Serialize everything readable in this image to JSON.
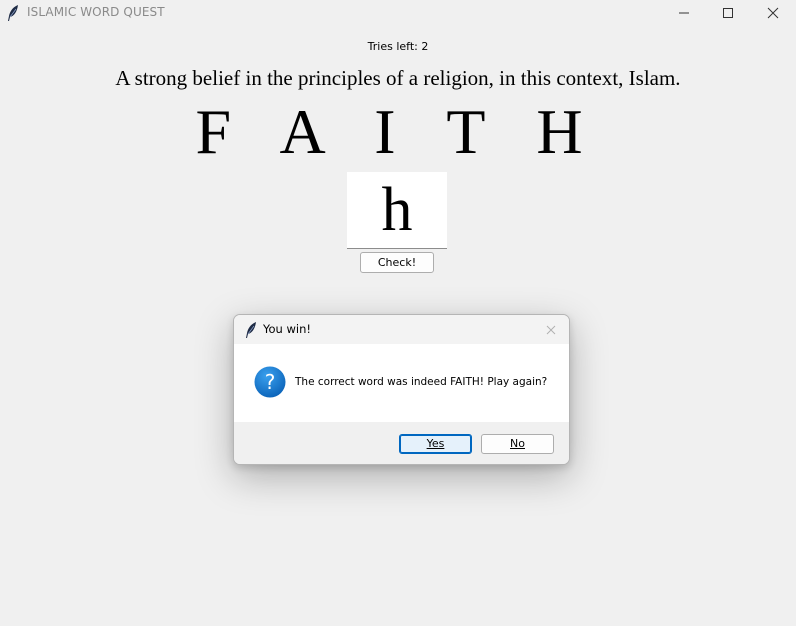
{
  "window": {
    "title": "ISLAMIC WORD QUEST",
    "app_icon": "feather-icon",
    "controls": [
      "minimize-icon",
      "maximize-icon",
      "close-icon"
    ]
  },
  "game": {
    "tries_label": "Tries left: 2",
    "hint": "A strong belief in the principles of a religion, in this context, Islam.",
    "word": "F A I T H",
    "input_value": "h",
    "check_button": "Check!"
  },
  "dialog": {
    "title": "You win!",
    "icon": "question-icon",
    "message": "The correct word was indeed FAITH! Play again?",
    "yes_label": "Yes",
    "no_label": "No",
    "accent_color": "#0067c0",
    "question_icon_color": "#1a7fd6"
  }
}
